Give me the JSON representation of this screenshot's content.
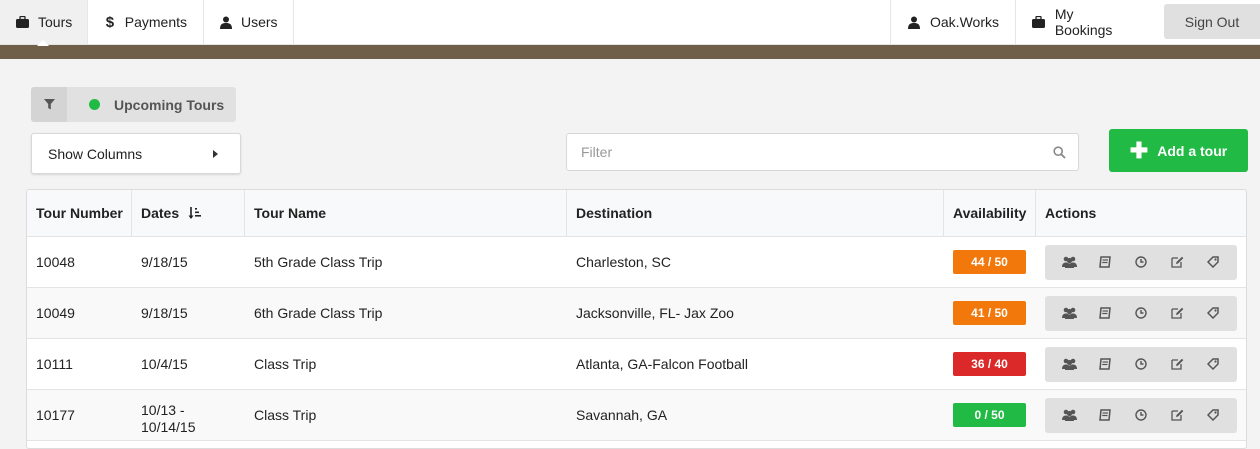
{
  "nav": {
    "tours": "Tours",
    "payments": "Payments",
    "users": "Users",
    "account": "Oak.Works",
    "bookings": "My Bookings",
    "signout": "Sign Out"
  },
  "upcoming": {
    "label": "Upcoming Tours",
    "dot_color": "#21ba45"
  },
  "show_columns": "Show Columns",
  "filter": {
    "placeholder": "Filter"
  },
  "add_tour": "Add a tour",
  "table": {
    "headers": [
      "Tour Number",
      "Dates",
      "Tour Name",
      "Destination",
      "Availability",
      "Actions"
    ],
    "rows": [
      {
        "number": "10048",
        "dates": "9/18/15",
        "dates2": "",
        "name": "5th Grade Class Trip",
        "destination": "Charleston, SC",
        "availability": "44 / 50",
        "color": "#f2780c"
      },
      {
        "number": "10049",
        "dates": "9/18/15",
        "dates2": "",
        "name": "6th Grade Class Trip",
        "destination": "Jacksonville, FL- Jax Zoo",
        "availability": "41 / 50",
        "color": "#f2780c"
      },
      {
        "number": "10111",
        "dates": "10/4/15",
        "dates2": "",
        "name": "Class Trip",
        "destination": "Atlanta, GA-Falcon Football",
        "availability": "36 / 40",
        "color": "#db2828"
      },
      {
        "number": "10177",
        "dates": "10/13 -",
        "dates2": "10/14/15",
        "name": "Class Trip",
        "destination": "Savannah, GA",
        "availability": "0 / 50",
        "color": "#21ba45"
      }
    ]
  },
  "colors": {
    "brown_bar": "#6f5f49",
    "green": "#21ba45",
    "orange": "#f2780c",
    "red": "#db2828"
  },
  "icons": [
    "briefcase-icon",
    "dollar-icon",
    "user-icon",
    "filter-icon",
    "search-icon",
    "users-icon",
    "book-icon",
    "clock-icon",
    "edit-icon",
    "tag-icon",
    "sort-icon"
  ]
}
